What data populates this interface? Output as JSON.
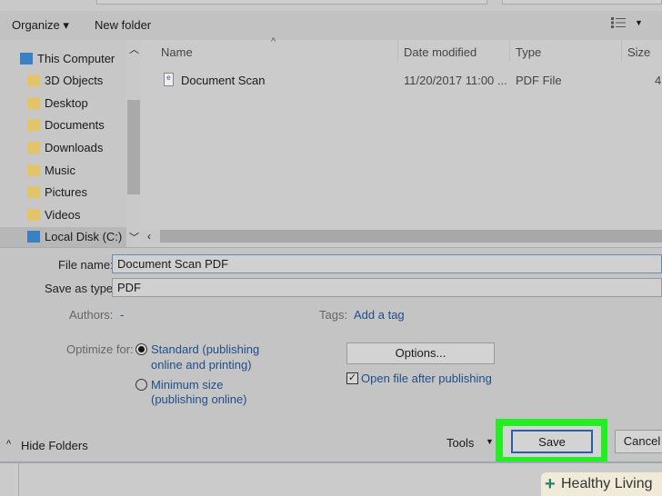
{
  "toolbar": {
    "organize": "Organize ▾",
    "new_folder": "New folder",
    "view_icon": "details-view-icon"
  },
  "nav": {
    "items": [
      {
        "label": "This Computer",
        "icon": "computer-icon",
        "color": "#3b7fc4"
      },
      {
        "label": "3D Objects",
        "icon": "folder-3d-icon",
        "color": "#e2c46a"
      },
      {
        "label": "Desktop",
        "icon": "folder-desktop-icon",
        "color": "#e2c46a"
      },
      {
        "label": "Documents",
        "icon": "folder-documents-icon",
        "color": "#e2c46a"
      },
      {
        "label": "Downloads",
        "icon": "folder-downloads-icon",
        "color": "#e2c46a"
      },
      {
        "label": "Music",
        "icon": "folder-music-icon",
        "color": "#e2c46a"
      },
      {
        "label": "Pictures",
        "icon": "folder-pictures-icon",
        "color": "#e2c46a"
      },
      {
        "label": "Videos",
        "icon": "folder-videos-icon",
        "color": "#e2c46a"
      },
      {
        "label": "Local Disk (C:)",
        "icon": "drive-icon",
        "color": "#3b7fc4"
      }
    ]
  },
  "columns": {
    "name": "Name",
    "date": "Date modified",
    "type": "Type",
    "size": "Size"
  },
  "files": [
    {
      "name": "Document Scan",
      "date": "11/20/2017 11:00 ...",
      "type": "PDF File",
      "size": "4"
    }
  ],
  "form": {
    "file_name_label": "File name:",
    "file_name_value": "Document Scan PDF",
    "save_type_label": "Save as type:",
    "save_type_value": "PDF",
    "authors_label": "Authors:",
    "authors_value": "-",
    "tags_label": "Tags:",
    "tags_value": "Add a tag",
    "optimize_label": "Optimize for:",
    "opt_standard_1": "Standard (publishing",
    "opt_standard_2": "online and printing)",
    "opt_min_1": "Minimum size",
    "opt_min_2": "(publishing online)",
    "options_button": "Options...",
    "open_after": "Open file after publishing",
    "open_after_checked": true,
    "selected_option": "standard"
  },
  "footer": {
    "hide_folders": "Hide Folders",
    "tools": "Tools",
    "save": "Save",
    "cancel": "Cancel"
  },
  "highlight_color": "#22ee22",
  "watermark": "Healthy Living"
}
